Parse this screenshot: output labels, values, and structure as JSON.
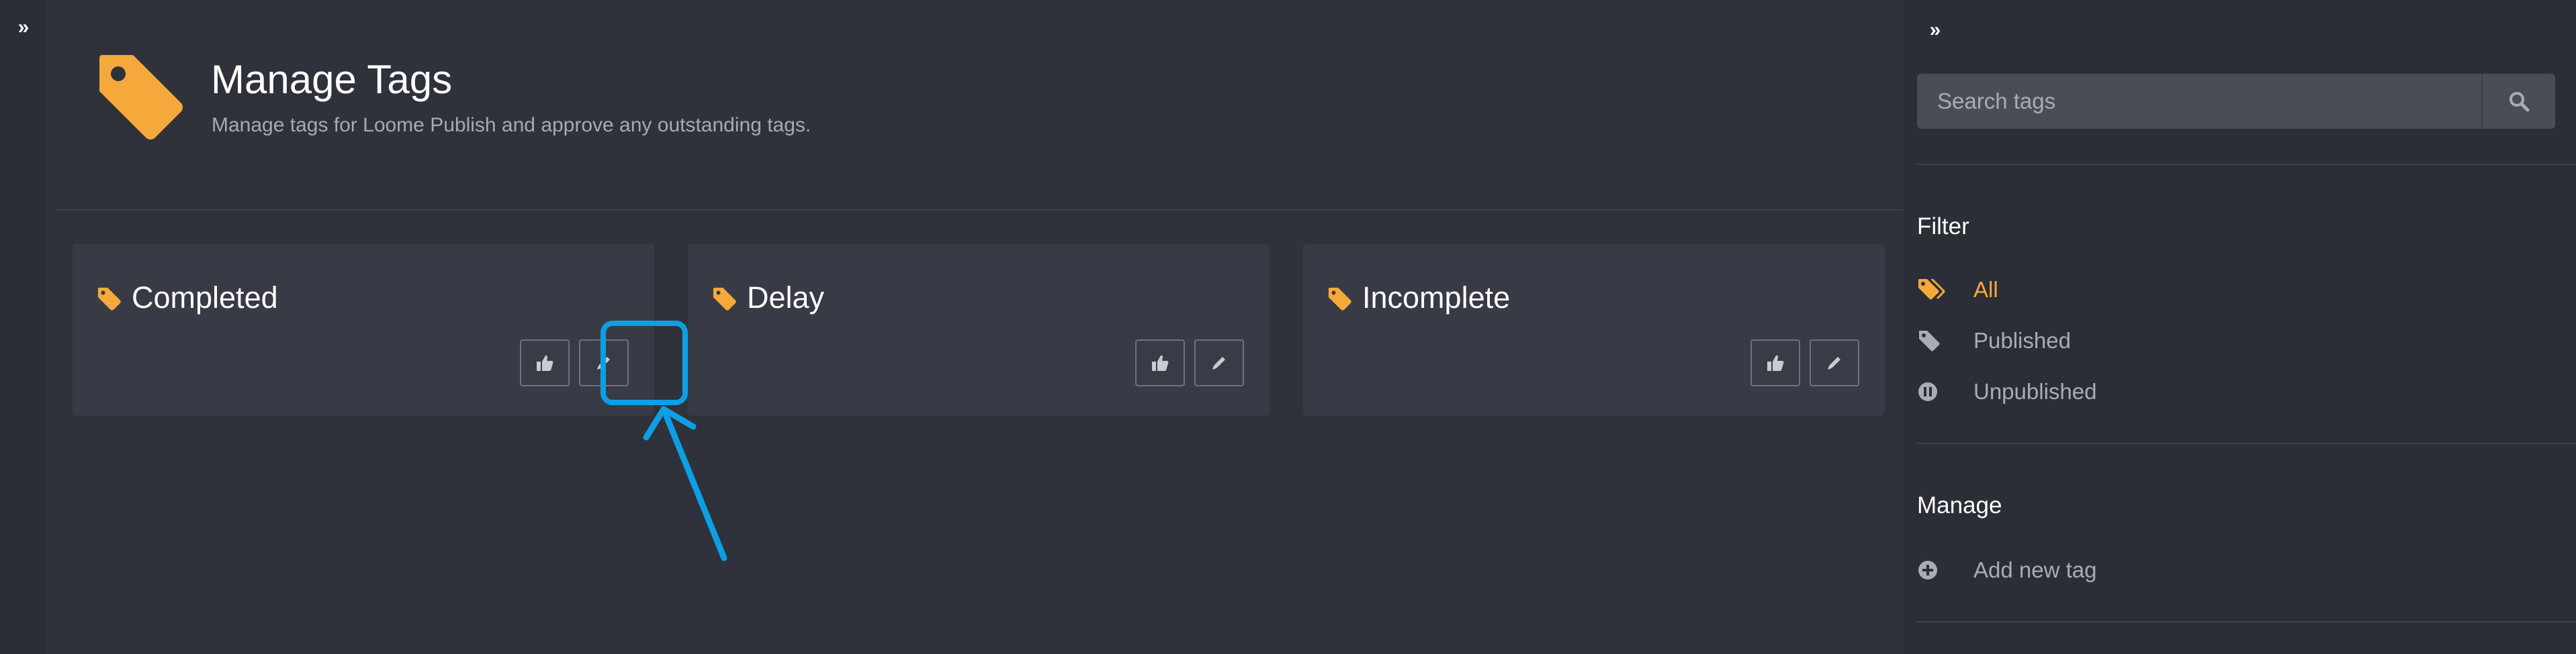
{
  "left_rail": {
    "expand_glyph": "»"
  },
  "header": {
    "title": "Manage Tags",
    "subtitle": "Manage tags for Loome Publish and approve any outstanding tags."
  },
  "tags": [
    {
      "name": "Completed"
    },
    {
      "name": "Delay"
    },
    {
      "name": "Incomplete"
    }
  ],
  "sidebar": {
    "collapse_glyph": "»",
    "search": {
      "placeholder": "Search tags",
      "value": ""
    },
    "filter": {
      "title": "Filter",
      "items": [
        {
          "label": "All",
          "icon": "tags-icon",
          "active": true
        },
        {
          "label": "Published",
          "icon": "tag-icon",
          "active": false
        },
        {
          "label": "Unpublished",
          "icon": "pause-circle-icon",
          "active": false
        }
      ]
    },
    "manage": {
      "title": "Manage",
      "items": [
        {
          "label": "Add new tag",
          "icon": "plus-circle-icon"
        }
      ]
    }
  },
  "colors": {
    "accent": "#f6a93b",
    "background": "#2f323b",
    "card": "#383b45",
    "highlight": "#0d9fe6"
  }
}
